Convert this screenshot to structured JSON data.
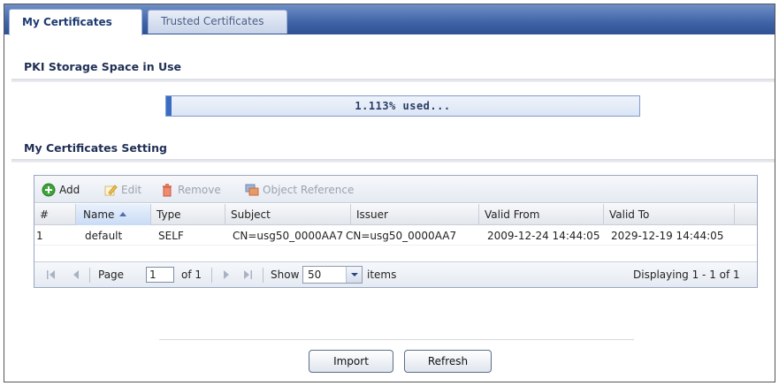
{
  "tabs": [
    {
      "label": "My Certificates",
      "active": true
    },
    {
      "label": "Trusted Certificates",
      "active": false
    }
  ],
  "storage": {
    "title": "PKI Storage Space in Use",
    "percent_used": 1.113,
    "text": "1.113% used..."
  },
  "certs": {
    "title": "My Certificates Setting",
    "toolbar": {
      "add": "Add",
      "edit": "Edit",
      "remove": "Remove",
      "object_reference": "Object Reference"
    },
    "columns": [
      "#",
      "Name",
      "Type",
      "Subject",
      "Issuer",
      "Valid From",
      "Valid To"
    ],
    "sorted_column": "Name",
    "rows": [
      {
        "num": "1",
        "name": "default",
        "type": "SELF",
        "subject": "CN=usg50_0000AA7",
        "issuer": "CN=usg50_0000AA7",
        "valid_from": "2009-12-24 14:44:05",
        "valid_to": "2029-12-19 14:44:05"
      }
    ],
    "pager": {
      "page_label": "Page",
      "page_value": "1",
      "of_label": "of 1",
      "show_label": "Show",
      "show_value": "50",
      "items_label": "items",
      "displaying": "Displaying 1 - 1 of 1"
    }
  },
  "buttons": {
    "import": "Import",
    "refresh": "Refresh"
  },
  "colors": {
    "tab_bar": "#3f63a6",
    "section_title": "#1f2f55",
    "progress_fill": "#3b6cc4"
  }
}
